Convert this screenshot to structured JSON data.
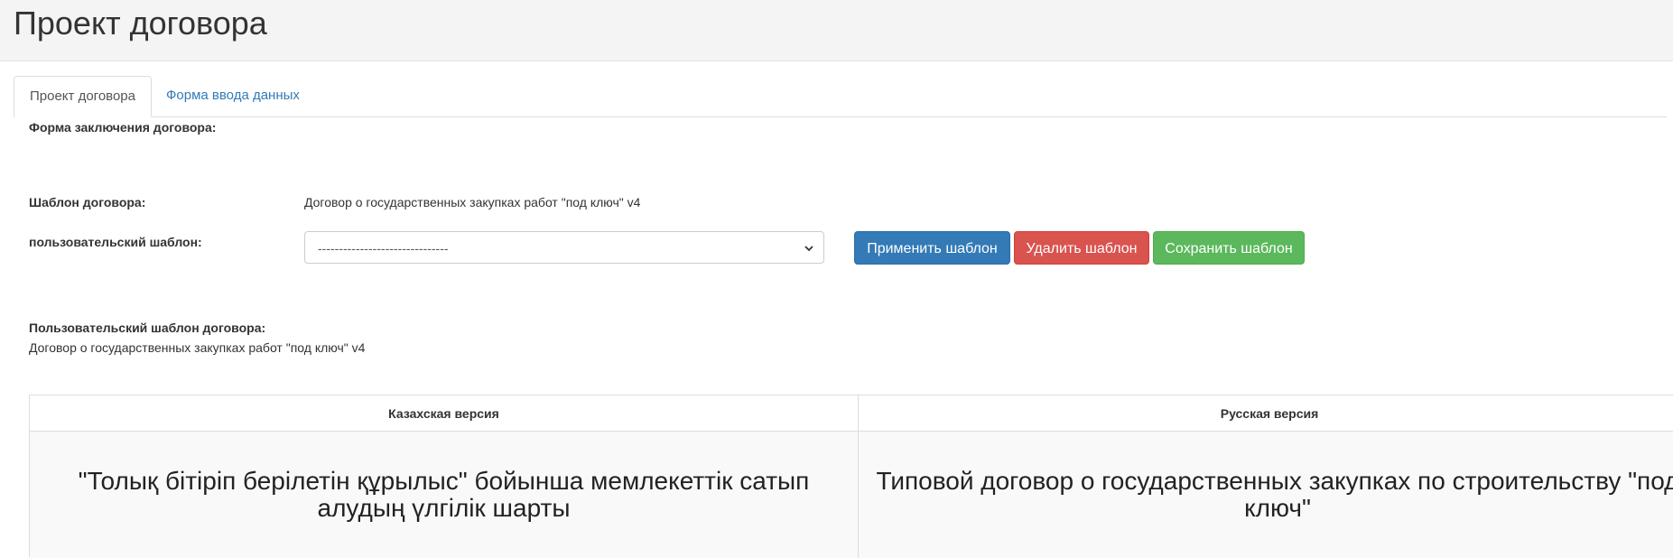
{
  "page": {
    "title": "Проект договора"
  },
  "tabs": [
    {
      "label": "Проект договора",
      "active": true
    },
    {
      "label": "Форма ввода данных",
      "active": false
    }
  ],
  "form": {
    "conclusion_label": "Форма заключения договора:",
    "template_label": "Шаблон договора:",
    "template_value": "Договор о государственных закупках работ \"под ключ\" v4",
    "user_template_label": "пользовательский шаблон:",
    "user_template_select_value": "-------------------------------",
    "user_contract_template_label": "Пользовательский шаблон договора:",
    "user_contract_template_value": "Договор о государственных закупках работ \"под ключ\" v4"
  },
  "buttons": {
    "apply": "Применить шаблон",
    "delete": "Удалить шаблон",
    "save": "Сохранить шаблон"
  },
  "table": {
    "headers": [
      "Казахская версия",
      "Русская версия"
    ],
    "kz_text": "\"Толық бітіріп берілетін құрылыс\" бойынша мемлекеттік сатып алудың үлгілік шарты",
    "ru_text": "Типовой договор о государственных закупках по строительству \"под ключ\""
  },
  "colors": {
    "primary": "#337ab7",
    "danger": "#d9534f",
    "success": "#5cb85c",
    "link": "#337ab7"
  }
}
